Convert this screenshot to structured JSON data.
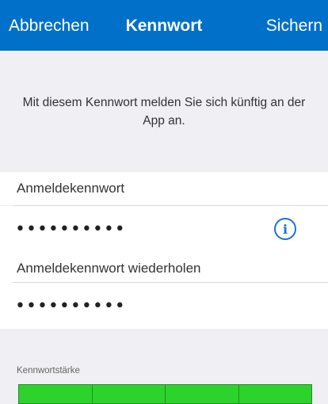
{
  "navbar": {
    "cancel_label": "Abbrechen",
    "title": "Kennwort",
    "save_label": "Sichern",
    "background_color": "#0070c9"
  },
  "intro": {
    "text": "Mit diesem Kennwort melden Sie sich künftig an der App an."
  },
  "password": {
    "label": "Anmeldekennwort",
    "value": "••••••••••",
    "info_icon": "info-circle-icon"
  },
  "password_repeat": {
    "label": "Anmeldekennwort wiederholen",
    "value": "••••••••••"
  },
  "strength": {
    "label": "Kennwortstärke",
    "filled_segments": 4,
    "total_segments": 4,
    "fill_color": "#2bd32b"
  }
}
